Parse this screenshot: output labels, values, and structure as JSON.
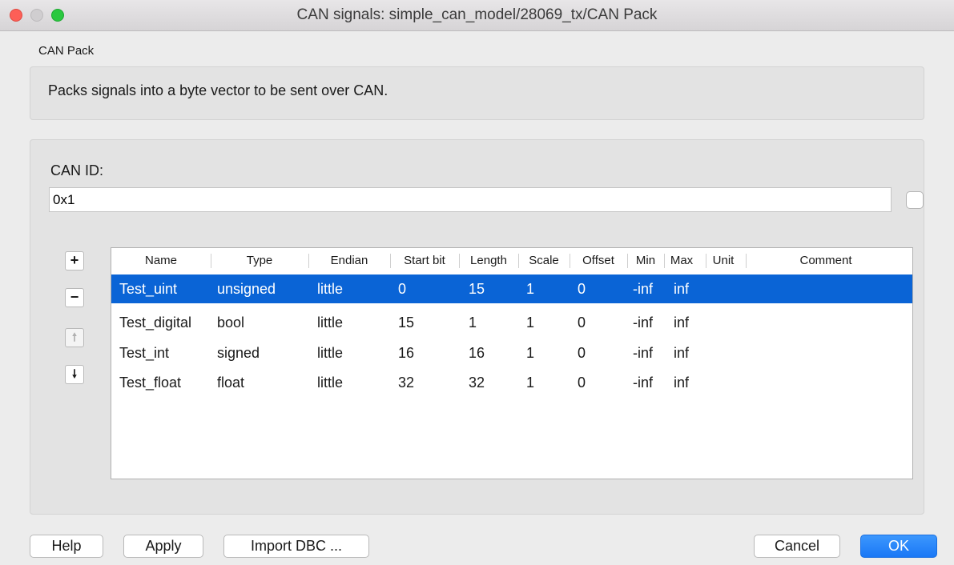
{
  "window": {
    "title": "CAN signals: simple_can_model/28069_tx/CAN Pack"
  },
  "section": {
    "label": "CAN Pack",
    "description": "Packs signals into a byte vector to be sent over CAN."
  },
  "can_id": {
    "label": "CAN ID:",
    "value": "0x1",
    "checked": false
  },
  "side_buttons": {
    "add": "+",
    "remove": "−",
    "up": "🠕",
    "down": "🠗"
  },
  "table": {
    "columns": [
      "Name",
      "Type",
      "Endian",
      "Start bit",
      "Length",
      "Scale",
      "Offset",
      "Min",
      "Max",
      "Unit",
      "Comment"
    ],
    "rows": [
      [
        "Test_uint",
        "unsigned",
        "little",
        "0",
        "15",
        "1",
        "0",
        "-inf",
        "inf",
        "",
        ""
      ],
      [
        "Test_digital",
        "bool",
        "little",
        "15",
        "1",
        "1",
        "0",
        "-inf",
        "inf",
        "",
        ""
      ],
      [
        "Test_int",
        "signed",
        "little",
        "16",
        "16",
        "1",
        "0",
        "-inf",
        "inf",
        "",
        ""
      ],
      [
        "Test_float",
        "float",
        "little",
        "32",
        "32",
        "1",
        "0",
        "-inf",
        "inf",
        "",
        ""
      ]
    ],
    "selected_row": 0
  },
  "buttons": {
    "help": "Help",
    "apply": "Apply",
    "import_dbc": "Import DBC ...",
    "cancel": "Cancel",
    "ok": "OK"
  },
  "colors": {
    "selection": "#0a64d6",
    "primary_button": "#1a78f6"
  }
}
